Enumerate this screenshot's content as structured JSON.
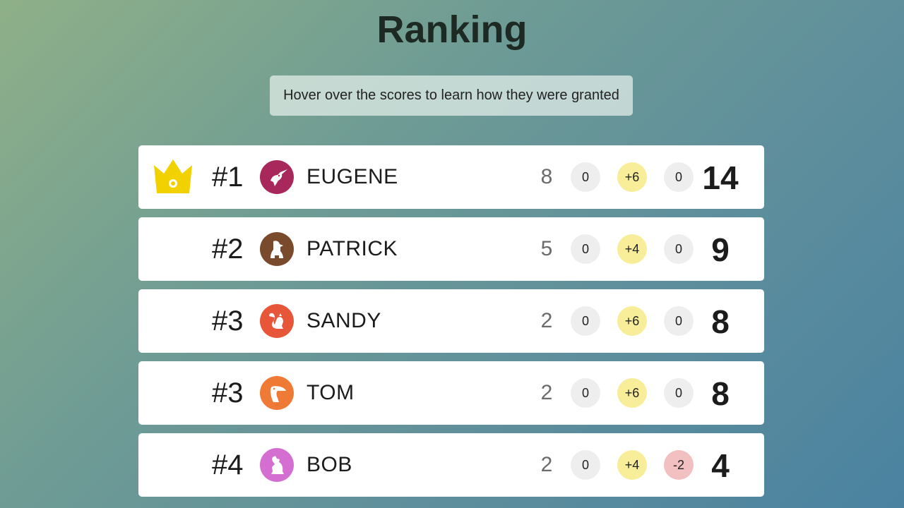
{
  "page": {
    "title": "Ranking",
    "hint": "Hover over the scores to learn how they were granted"
  },
  "colors": {
    "crown": "#f2d100",
    "score_neutral_bg": "#eeeeee",
    "score_bonus_bg": "#f8ee99",
    "score_penalty_bg": "#f2c0c0"
  },
  "players": [
    {
      "rank": "#1",
      "name": "EUGENE",
      "base": "8",
      "s1": "0",
      "s2": "+6",
      "s3": "0",
      "total": "14",
      "avatar_icon": "hummingbird-icon",
      "avatar_color": "#a8285c",
      "leader": true
    },
    {
      "rank": "#2",
      "name": "PATRICK",
      "base": "5",
      "s1": "0",
      "s2": "+4",
      "s3": "0",
      "total": "9",
      "avatar_icon": "dog-icon",
      "avatar_color": "#7a4a2c",
      "leader": false
    },
    {
      "rank": "#3",
      "name": "SANDY",
      "base": "2",
      "s1": "0",
      "s2": "+6",
      "s3": "0",
      "total": "8",
      "avatar_icon": "squirrel-icon",
      "avatar_color": "#e8563a",
      "leader": false
    },
    {
      "rank": "#3",
      "name": "TOM",
      "base": "2",
      "s1": "0",
      "s2": "+6",
      "s3": "0",
      "total": "8",
      "avatar_icon": "toucan-icon",
      "avatar_color": "#ef7a35",
      "leader": false
    },
    {
      "rank": "#4",
      "name": "BOB",
      "base": "2",
      "s1": "0",
      "s2": "+4",
      "s3": "-2",
      "total": "4",
      "avatar_icon": "dog-sitting-icon",
      "avatar_color": "#d46ed1",
      "leader": false
    }
  ]
}
